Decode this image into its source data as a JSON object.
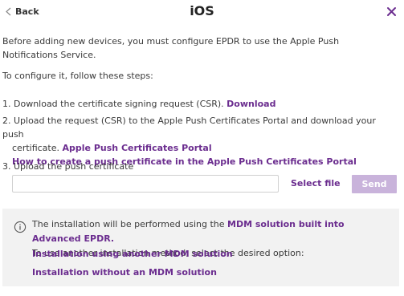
{
  "header": {
    "back_label": "Back",
    "title": "iOS"
  },
  "intro": {
    "line1": "Before adding new devices, you must configure EPDR to use the Apple Push",
    "line2": "Notifications Service.",
    "configure": "To configure it, follow these steps:"
  },
  "steps": {
    "step1_text": "1. Download the certificate signing request (CSR).",
    "step1_link": "Download",
    "step2_line1": "2. Upload the request (CSR) to the Apple Push Certificates Portal and download your push",
    "step2_line2": "certificate.",
    "step2_link1": "Apple Push Certificates Portal",
    "step2_link2": "How to create a push certificate in the Apple Push Certificates Portal",
    "step3_text": "3. Upload the push certificate"
  },
  "upload": {
    "input_value": "",
    "select_file_label": "Select file",
    "send_label": "Send"
  },
  "info": {
    "line1_prefix": "The installation will be performed using the",
    "line1_link": "MDM solution built into Advanced EPDR.",
    "line2": "To use another installation method, select the desired option:",
    "option1": "Installation using another MDM solution",
    "option2": "Installation without an MDM solution"
  },
  "colors": {
    "accent": "#6b2d8f",
    "send_disabled": "#c9b3db",
    "info_bg": "#f2f2f2"
  },
  "icons": {
    "back": "chevron-left-icon",
    "close": "close-icon",
    "info": "info-icon"
  }
}
